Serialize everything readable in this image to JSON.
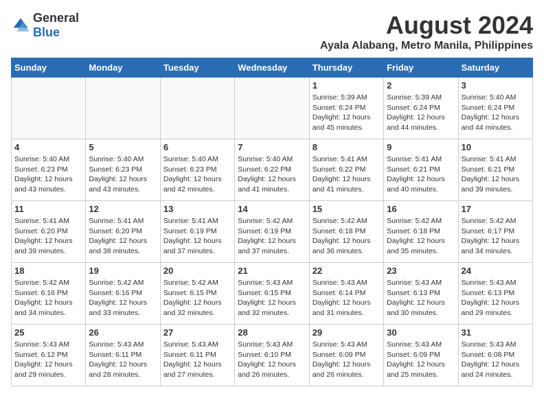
{
  "logo": {
    "general": "General",
    "blue": "Blue"
  },
  "title": "August 2024",
  "subtitle": "Ayala Alabang, Metro Manila, Philippines",
  "weekdays": [
    "Sunday",
    "Monday",
    "Tuesday",
    "Wednesday",
    "Thursday",
    "Friday",
    "Saturday"
  ],
  "weeks": [
    [
      {
        "day": "",
        "info": ""
      },
      {
        "day": "",
        "info": ""
      },
      {
        "day": "",
        "info": ""
      },
      {
        "day": "",
        "info": ""
      },
      {
        "day": "1",
        "info": "Sunrise: 5:39 AM\nSunset: 6:24 PM\nDaylight: 12 hours\nand 45 minutes."
      },
      {
        "day": "2",
        "info": "Sunrise: 5:39 AM\nSunset: 6:24 PM\nDaylight: 12 hours\nand 44 minutes."
      },
      {
        "day": "3",
        "info": "Sunrise: 5:40 AM\nSunset: 6:24 PM\nDaylight: 12 hours\nand 44 minutes."
      }
    ],
    [
      {
        "day": "4",
        "info": "Sunrise: 5:40 AM\nSunset: 6:23 PM\nDaylight: 12 hours\nand 43 minutes."
      },
      {
        "day": "5",
        "info": "Sunrise: 5:40 AM\nSunset: 6:23 PM\nDaylight: 12 hours\nand 43 minutes."
      },
      {
        "day": "6",
        "info": "Sunrise: 5:40 AM\nSunset: 6:23 PM\nDaylight: 12 hours\nand 42 minutes."
      },
      {
        "day": "7",
        "info": "Sunrise: 5:40 AM\nSunset: 6:22 PM\nDaylight: 12 hours\nand 41 minutes."
      },
      {
        "day": "8",
        "info": "Sunrise: 5:41 AM\nSunset: 6:22 PM\nDaylight: 12 hours\nand 41 minutes."
      },
      {
        "day": "9",
        "info": "Sunrise: 5:41 AM\nSunset: 6:21 PM\nDaylight: 12 hours\nand 40 minutes."
      },
      {
        "day": "10",
        "info": "Sunrise: 5:41 AM\nSunset: 6:21 PM\nDaylight: 12 hours\nand 39 minutes."
      }
    ],
    [
      {
        "day": "11",
        "info": "Sunrise: 5:41 AM\nSunset: 6:20 PM\nDaylight: 12 hours\nand 39 minutes."
      },
      {
        "day": "12",
        "info": "Sunrise: 5:41 AM\nSunset: 6:20 PM\nDaylight: 12 hours\nand 38 minutes."
      },
      {
        "day": "13",
        "info": "Sunrise: 5:41 AM\nSunset: 6:19 PM\nDaylight: 12 hours\nand 37 minutes."
      },
      {
        "day": "14",
        "info": "Sunrise: 5:42 AM\nSunset: 6:19 PM\nDaylight: 12 hours\nand 37 minutes."
      },
      {
        "day": "15",
        "info": "Sunrise: 5:42 AM\nSunset: 6:18 PM\nDaylight: 12 hours\nand 36 minutes."
      },
      {
        "day": "16",
        "info": "Sunrise: 5:42 AM\nSunset: 6:18 PM\nDaylight: 12 hours\nand 35 minutes."
      },
      {
        "day": "17",
        "info": "Sunrise: 5:42 AM\nSunset: 6:17 PM\nDaylight: 12 hours\nand 34 minutes."
      }
    ],
    [
      {
        "day": "18",
        "info": "Sunrise: 5:42 AM\nSunset: 6:16 PM\nDaylight: 12 hours\nand 34 minutes."
      },
      {
        "day": "19",
        "info": "Sunrise: 5:42 AM\nSunset: 6:16 PM\nDaylight: 12 hours\nand 33 minutes."
      },
      {
        "day": "20",
        "info": "Sunrise: 5:42 AM\nSunset: 6:15 PM\nDaylight: 12 hours\nand 32 minutes."
      },
      {
        "day": "21",
        "info": "Sunrise: 5:43 AM\nSunset: 6:15 PM\nDaylight: 12 hours\nand 32 minutes."
      },
      {
        "day": "22",
        "info": "Sunrise: 5:43 AM\nSunset: 6:14 PM\nDaylight: 12 hours\nand 31 minutes."
      },
      {
        "day": "23",
        "info": "Sunrise: 5:43 AM\nSunset: 6:13 PM\nDaylight: 12 hours\nand 30 minutes."
      },
      {
        "day": "24",
        "info": "Sunrise: 5:43 AM\nSunset: 6:13 PM\nDaylight: 12 hours\nand 29 minutes."
      }
    ],
    [
      {
        "day": "25",
        "info": "Sunrise: 5:43 AM\nSunset: 6:12 PM\nDaylight: 12 hours\nand 29 minutes."
      },
      {
        "day": "26",
        "info": "Sunrise: 5:43 AM\nSunset: 6:11 PM\nDaylight: 12 hours\nand 28 minutes."
      },
      {
        "day": "27",
        "info": "Sunrise: 5:43 AM\nSunset: 6:11 PM\nDaylight: 12 hours\nand 27 minutes."
      },
      {
        "day": "28",
        "info": "Sunrise: 5:43 AM\nSunset: 6:10 PM\nDaylight: 12 hours\nand 26 minutes."
      },
      {
        "day": "29",
        "info": "Sunrise: 5:43 AM\nSunset: 6:09 PM\nDaylight: 12 hours\nand 26 minutes."
      },
      {
        "day": "30",
        "info": "Sunrise: 5:43 AM\nSunset: 6:09 PM\nDaylight: 12 hours\nand 25 minutes."
      },
      {
        "day": "31",
        "info": "Sunrise: 5:43 AM\nSunset: 6:08 PM\nDaylight: 12 hours\nand 24 minutes."
      }
    ]
  ]
}
